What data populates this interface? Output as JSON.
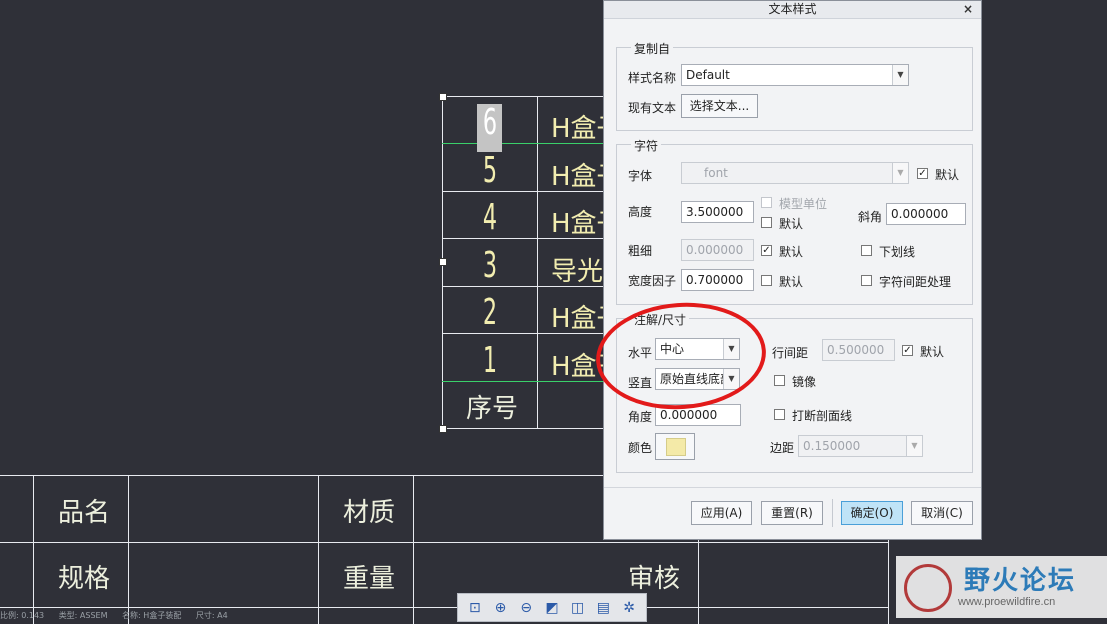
{
  "bom_table": {
    "rows": [
      {
        "num": "6",
        "name": "H盒子"
      },
      {
        "num": "5",
        "name": "H盒子"
      },
      {
        "num": "4",
        "name": "H盒子"
      },
      {
        "num": "3",
        "name": "导光板"
      },
      {
        "num": "2",
        "name": "H盒子"
      },
      {
        "num": "1",
        "name": "H盒子"
      }
    ],
    "header": "序号"
  },
  "title_block": {
    "product_name_label": "品名",
    "material_label": "材质",
    "spec_label": "规格",
    "weight_label": "重量",
    "review_label": "审核"
  },
  "status_bar": {
    "scale": "比例: 0.143",
    "type": "类型: ASSEM",
    "name": "名称: H盒子装配",
    "size": "尺寸: A4"
  },
  "toolbar": {
    "icons": [
      "zoom-fit-icon",
      "zoom-in-icon",
      "zoom-out-icon",
      "repaint-icon",
      "view-3d-icon",
      "layers-icon",
      "settings-icon"
    ]
  },
  "watermark": {
    "title": "野火论坛",
    "url": "www.proewildfire.cn"
  },
  "dialog": {
    "title": "文本样式",
    "copy_from": {
      "group_title": "复制自",
      "style_name_label": "样式名称",
      "style_name_value": "Default",
      "existing_text_label": "现有文本",
      "select_text_button": "选择文本..."
    },
    "character": {
      "group_title": "字符",
      "font_label": "字体",
      "font_value": "font",
      "font_default_label": "默认",
      "font_default_checked": true,
      "height_label": "高度",
      "height_value": "3.500000",
      "model_units_label": "模型单位",
      "height_default_label": "默认",
      "slant_label": "斜角",
      "slant_value": "0.000000",
      "thickness_label": "粗细",
      "thickness_value": "0.000000",
      "thickness_default_label": "默认",
      "thickness_default_checked": true,
      "underline_label": "下划线",
      "width_factor_label": "宽度因子",
      "width_factor_value": "0.700000",
      "width_default_label": "默认",
      "kerning_label": "字符间距处理"
    },
    "note_dim": {
      "group_title": "注解/尺寸",
      "horizontal_label": "水平",
      "horizontal_value": "中心",
      "vertical_label": "竖直",
      "vertical_value": "原始直线底部",
      "line_spacing_label": "行间距",
      "line_spacing_value": "0.500000",
      "line_spacing_default_label": "默认",
      "line_spacing_default_checked": true,
      "mirror_label": "镜像",
      "angle_label": "角度",
      "angle_value": "0.000000",
      "break_hatch_label": "打断剖面线",
      "color_label": "颜色",
      "color_value": "#f4eaa8",
      "margin_label": "边距",
      "margin_value": "0.150000"
    },
    "buttons": {
      "apply": "应用(A)",
      "reset": "重置(R)",
      "ok": "确定(O)",
      "cancel": "取消(C)"
    }
  }
}
